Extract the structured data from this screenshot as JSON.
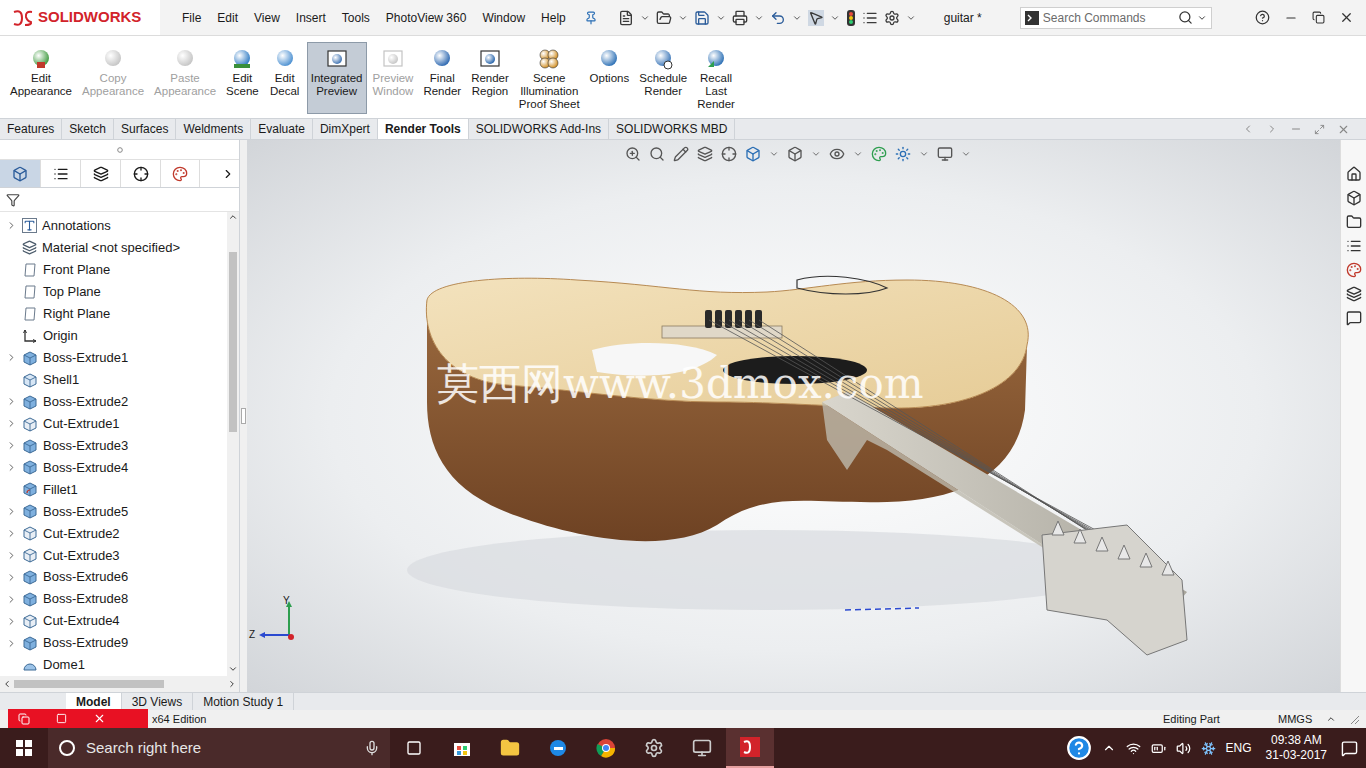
{
  "app": {
    "logo": "SOLIDWORKS",
    "document": "guitar *"
  },
  "menu": [
    "File",
    "Edit",
    "View",
    "Insert",
    "Tools",
    "PhotoView 360",
    "Window",
    "Help"
  ],
  "search": {
    "placeholder": "Search Commands"
  },
  "ribbon": [
    {
      "lines": [
        "Edit",
        "Appearance"
      ],
      "kind": "appearance",
      "disabled": false,
      "selected": false
    },
    {
      "lines": [
        "Copy",
        "Appearance"
      ],
      "kind": "copy",
      "disabled": true,
      "selected": false
    },
    {
      "lines": [
        "Paste",
        "Appearance"
      ],
      "kind": "paste",
      "disabled": true,
      "selected": false
    },
    {
      "lines": [
        "Edit",
        "Scene"
      ],
      "kind": "scene",
      "disabled": false,
      "selected": false
    },
    {
      "lines": [
        "Edit",
        "Decal"
      ],
      "kind": "decal",
      "disabled": false,
      "selected": false
    },
    {
      "lines": [
        "Integrated",
        "Preview"
      ],
      "kind": "preview",
      "disabled": false,
      "selected": true
    },
    {
      "lines": [
        "Preview",
        "Window"
      ],
      "kind": "window",
      "disabled": true,
      "selected": false
    },
    {
      "lines": [
        "Final",
        "Render"
      ],
      "kind": "render",
      "disabled": false,
      "selected": false
    },
    {
      "lines": [
        "Render",
        "Region"
      ],
      "kind": "region",
      "disabled": false,
      "selected": false
    },
    {
      "lines": [
        "Scene",
        "Illumination",
        "Proof Sheet"
      ],
      "kind": "proof",
      "disabled": false,
      "selected": false
    },
    {
      "lines": [
        "Options"
      ],
      "kind": "options",
      "disabled": false,
      "selected": false
    },
    {
      "lines": [
        "Schedule",
        "Render"
      ],
      "kind": "schedule",
      "disabled": false,
      "selected": false
    },
    {
      "lines": [
        "Recall",
        "Last",
        "Render"
      ],
      "kind": "recall",
      "disabled": false,
      "selected": false
    }
  ],
  "command_tabs": [
    {
      "label": "Features",
      "selected": false
    },
    {
      "label": "Sketch",
      "selected": false
    },
    {
      "label": "Surfaces",
      "selected": false
    },
    {
      "label": "Weldments",
      "selected": false
    },
    {
      "label": "Evaluate",
      "selected": false
    },
    {
      "label": "DimXpert",
      "selected": false
    },
    {
      "label": "Render Tools",
      "selected": true
    },
    {
      "label": "SOLIDWORKS Add-Ins",
      "selected": false
    },
    {
      "label": "SOLIDWORKS MBD",
      "selected": false
    }
  ],
  "feature_tree": {
    "items": [
      {
        "label": "Annotations",
        "kind": "annotations",
        "expandable": true
      },
      {
        "label": "Material <not specified>",
        "kind": "material",
        "expandable": false
      },
      {
        "label": "Front Plane",
        "kind": "plane",
        "expandable": false
      },
      {
        "label": "Top Plane",
        "kind": "plane",
        "expandable": false
      },
      {
        "label": "Right Plane",
        "kind": "plane",
        "expandable": false
      },
      {
        "label": "Origin",
        "kind": "origin",
        "expandable": false
      },
      {
        "label": "Boss-Extrude1",
        "kind": "boss",
        "expandable": true
      },
      {
        "label": "Shell1",
        "kind": "shell",
        "expandable": false
      },
      {
        "label": "Boss-Extrude2",
        "kind": "boss",
        "expandable": true
      },
      {
        "label": "Cut-Extrude1",
        "kind": "cut",
        "expandable": true
      },
      {
        "label": "Boss-Extrude3",
        "kind": "boss",
        "expandable": true
      },
      {
        "label": "Boss-Extrude4",
        "kind": "boss",
        "expandable": true
      },
      {
        "label": "Fillet1",
        "kind": "fillet",
        "expandable": false
      },
      {
        "label": "Boss-Extrude5",
        "kind": "boss",
        "expandable": true
      },
      {
        "label": "Cut-Extrude2",
        "kind": "cut",
        "expandable": true
      },
      {
        "label": "Cut-Extrude3",
        "kind": "cut",
        "expandable": true
      },
      {
        "label": "Boss-Extrude6",
        "kind": "boss",
        "expandable": true
      },
      {
        "label": "Boss-Extrude8",
        "kind": "boss",
        "expandable": true
      },
      {
        "label": "Cut-Extrude4",
        "kind": "cut",
        "expandable": true
      },
      {
        "label": "Boss-Extrude9",
        "kind": "boss",
        "expandable": true
      },
      {
        "label": "Dome1",
        "kind": "dome",
        "expandable": false
      }
    ]
  },
  "viewport": {
    "watermark": "莫西网www.3dmox.com",
    "triad": [
      "Y",
      "Z"
    ]
  },
  "bottom_tabs": [
    {
      "label": "Model",
      "selected": true
    },
    {
      "label": "3D Views",
      "selected": false
    },
    {
      "label": "Motion Study 1",
      "selected": false
    }
  ],
  "status_bar": {
    "left": "x64 Edition",
    "mode": "Editing Part",
    "units": "MMGS"
  },
  "taskbar": {
    "search_placeholder": "Search right here",
    "language": "ENG",
    "time": "09:38 AM",
    "date": "31-03-2017"
  }
}
